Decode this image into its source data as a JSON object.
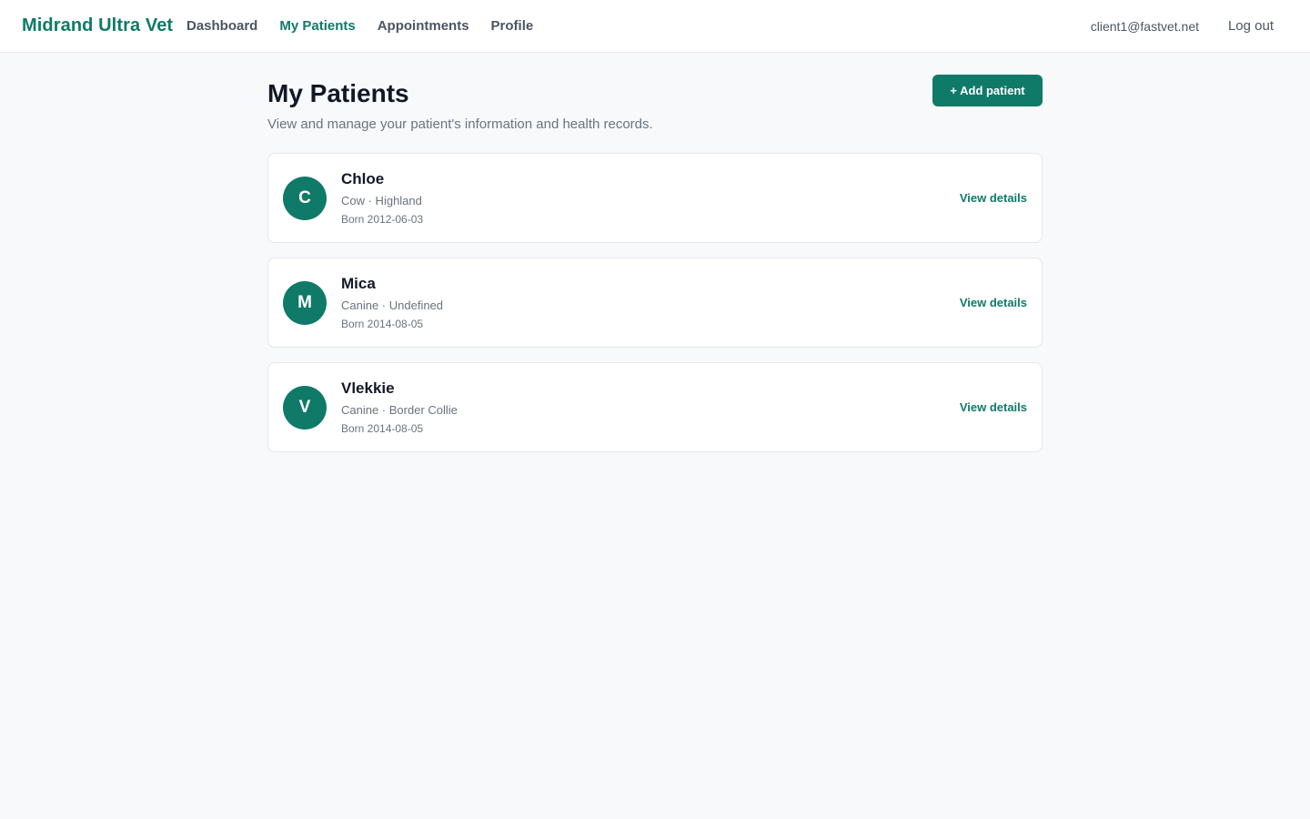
{
  "header": {
    "brand": "Midrand Ultra Vet",
    "nav": [
      {
        "label": "Dashboard",
        "active": false
      },
      {
        "label": "My Patients",
        "active": true
      },
      {
        "label": "Appointments",
        "active": false
      },
      {
        "label": "Profile",
        "active": false
      }
    ],
    "user_email": "client1@fastvet.net",
    "logout_label": "Log out"
  },
  "main": {
    "title": "My Patients",
    "subtitle": "View and manage your patient's information and health records.",
    "add_button_label": "+ Add patient",
    "patients": [
      {
        "initial": "C",
        "name": "Chloe",
        "species_breed": "Cow · Highland",
        "born": "Born 2012-06-03",
        "action": "View details"
      },
      {
        "initial": "M",
        "name": "Mica",
        "species_breed": "Canine · Undefined",
        "born": "Born 2014-08-05",
        "action": "View details"
      },
      {
        "initial": "V",
        "name": "Vlekkie",
        "species_breed": "Canine · Border Collie",
        "born": "Born 2014-08-05",
        "action": "View details"
      }
    ]
  },
  "colors": {
    "accent": "#0f7a68",
    "background": "#f8f9fb",
    "card": "#ffffff",
    "muted_text": "#6b7280"
  }
}
